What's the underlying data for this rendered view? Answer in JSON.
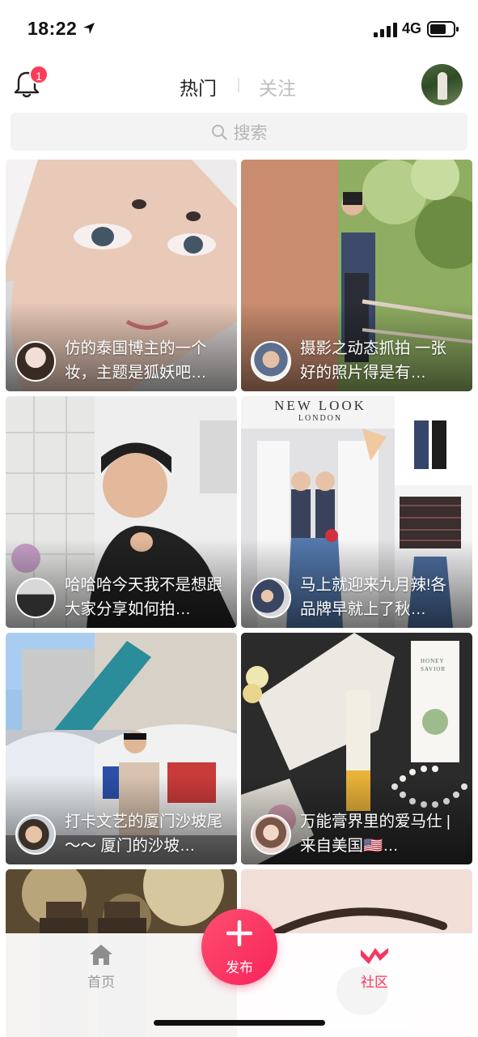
{
  "status_bar": {
    "time": "18:22",
    "network": "4G",
    "icons": [
      "location-arrow-icon",
      "signal-icon",
      "battery-icon"
    ]
  },
  "top_nav": {
    "notification_count": "1",
    "tabs": [
      {
        "label": "热门",
        "active": true
      },
      {
        "label": "关注",
        "active": false
      }
    ],
    "accent_color": "#ff3b58"
  },
  "search": {
    "placeholder": "搜索"
  },
  "feed": {
    "cards": [
      {
        "title": "仿的泰国博主的一个妆，主题是狐妖吧…"
      },
      {
        "title": "摄影之动态抓拍 一张好的照片得是有…"
      },
      {
        "title": "哈哈哈今天我不是想跟大家分享如何拍…"
      },
      {
        "title": "马上就迎来九月辣!各品牌早就上了秋…",
        "image_text": [
          "NEW LOOK",
          "LONDON"
        ]
      },
      {
        "title": "打卡文艺的厦门沙坡尾～～ 厦门的沙坡…"
      },
      {
        "title": "万能膏界里的爱马仕 | 来自美国🇺🇸…",
        "image_text": [
          "HONEY",
          "SAVIOR"
        ]
      },
      {
        "title": ""
      },
      {
        "title": ""
      }
    ]
  },
  "bottom_bar": {
    "home_label": "首页",
    "publish_label": "发布",
    "community_label": "社区",
    "active_color": "#f73762",
    "inactive_color": "#9a9a9a"
  }
}
